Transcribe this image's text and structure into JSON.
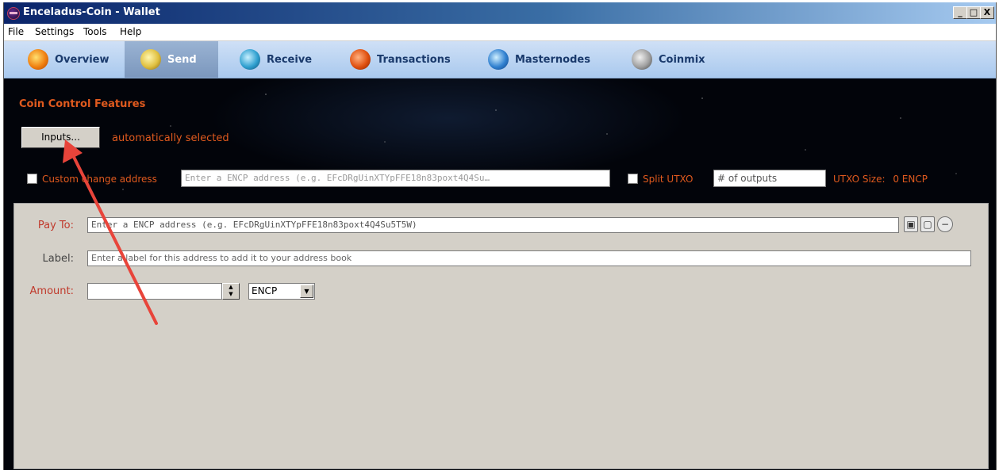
{
  "window": {
    "title": "Enceladus-Coin - Wallet",
    "controls": {
      "minimize": "_",
      "maximize": "□",
      "close": "X"
    }
  },
  "menu": [
    "File",
    "Settings",
    "Tools",
    "Help"
  ],
  "nav": [
    {
      "label": "Overview",
      "icon": "overview-icon"
    },
    {
      "label": "Send",
      "icon": "send-icon",
      "active": true
    },
    {
      "label": "Receive",
      "icon": "receive-icon"
    },
    {
      "label": "Transactions",
      "icon": "transactions-icon"
    },
    {
      "label": "Masternodes",
      "icon": "masternodes-icon"
    },
    {
      "label": "Coinmix",
      "icon": "coinmix-icon"
    }
  ],
  "coin_control": {
    "title": "Coin Control Features",
    "inputs_button": "Inputs...",
    "selection_status": "automatically selected",
    "custom_change_label": "Custom change address",
    "custom_change_placeholder": "Enter a ENCP address (e.g. EFcDRgUinXTYpFFE18n83poxt4Q4Su…",
    "split_utxo_label": "Split UTXO",
    "outputs_placeholder": "# of outputs",
    "utxo_size_label": "UTXO Size:",
    "utxo_size_value": "0 ENCP"
  },
  "recipient": {
    "pay_to_label": "Pay To:",
    "pay_to_placeholder": "Enter a ENCP address (e.g. EFcDRgUinXTYpFFE18n83poxt4Q4Su5T5W)",
    "label_label": "Label:",
    "label_placeholder": "Enter a label for this address to add it to your address book",
    "amount_label": "Amount:",
    "amount_value": "",
    "unit": "ENCP"
  },
  "colors": {
    "accent_red": "#e05a1e",
    "annotation_arrow": "#e8443a",
    "nav_bg": "#b8d3f2"
  }
}
